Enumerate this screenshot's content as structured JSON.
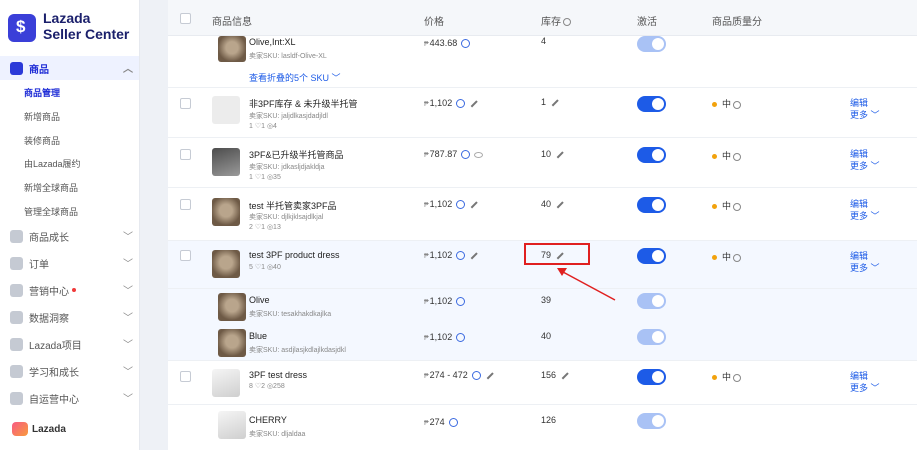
{
  "sidebar": {
    "logo_line1": "Lazada",
    "logo_line2": "Seller Center",
    "products": {
      "label": "商品",
      "sub": [
        "商品管理",
        "新增商品",
        "装修商品",
        "由Lazada履约",
        "新增全球商品",
        "管理全球商品"
      ]
    },
    "menu": [
      {
        "label": "商品成长"
      },
      {
        "label": "订单"
      },
      {
        "label": "营销中心"
      },
      {
        "label": "数据洞察"
      },
      {
        "label": "Lazada项目"
      },
      {
        "label": "学习和成长"
      },
      {
        "label": "自运营中心"
      }
    ],
    "bottom_logo": "Lazada"
  },
  "table": {
    "headers": {
      "info": "商品信息",
      "price": "价格",
      "stock": "库存",
      "active": "激活",
      "quality": "商品质量分"
    },
    "currency": "₱",
    "sku_prefix": "卖家SKU:",
    "top_variant": {
      "name": "Olive,Int:XL",
      "sku": "卖家SKU: lasldf-Olive-XL",
      "price": "443.68",
      "stock": "4"
    },
    "show_folded": "查看折叠的5个 SKU",
    "rows": [
      {
        "name": "非3PF库存 & 未升级半托管",
        "sku": "卖家SKU: jaljdlkasjdadjldl",
        "stats": "1   ♡1   ◎4",
        "price": "1,102",
        "stock": "1",
        "quality": "中",
        "edit": "编辑",
        "more": "更多"
      },
      {
        "name": "3PF&已升级半托管商品",
        "sku": "卖家SKU: jdkasljdjakldja",
        "stats": "1   ♡1   ◎35",
        "price": "787.87",
        "stock": "10",
        "quality": "中",
        "edit": "编辑",
        "more": "更多"
      },
      {
        "name": "test 半托管卖家3PF品",
        "sku": "卖家SKU: djlkjklsajdlkjal",
        "stats": "2   ♡1   ◎13",
        "price": "1,102",
        "stock": "40",
        "quality": "中",
        "edit": "编辑",
        "more": "更多"
      },
      {
        "name": "test 3PF product dress",
        "sku": "",
        "stats": "5   ♡1   ◎40",
        "price": "1,102",
        "stock": "79",
        "quality": "中",
        "edit": "编辑",
        "more": "更多"
      },
      {
        "name": "3PF test dress",
        "sku": "",
        "stats": "8   ♡2   ◎258",
        "price": "274 - 472",
        "stock": "156",
        "quality": "中",
        "edit": "编辑",
        "more": "更多"
      }
    ],
    "variants": [
      {
        "name": "Olive",
        "sku": "卖家SKU: tesakhakdkajlka",
        "price": "1,102",
        "stock": "39"
      },
      {
        "name": "Blue",
        "sku": "卖家SKU: asdjlasjkdlajlkdasjdkl",
        "price": "1,102",
        "stock": "40"
      },
      {
        "name": "CHERRY",
        "sku": "卖家SKU: dljaldaa",
        "price": "274",
        "stock": "126"
      }
    ]
  }
}
